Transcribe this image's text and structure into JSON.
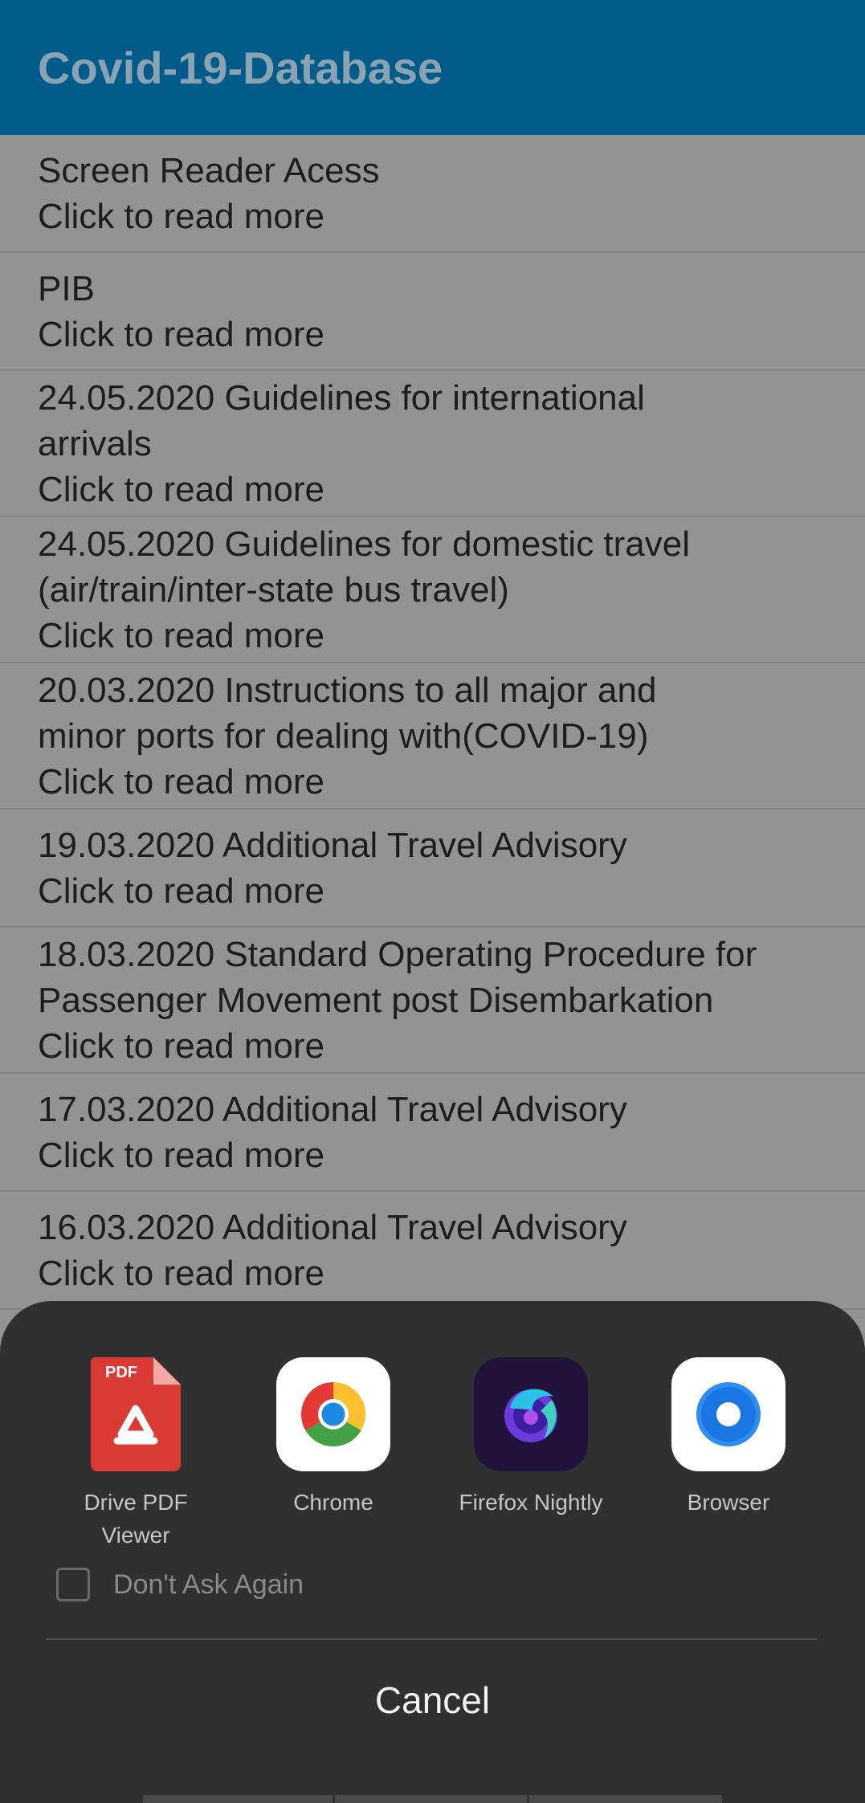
{
  "app": {
    "title": "Covid-19-Database"
  },
  "list": [
    {
      "title": "Screen Reader Acess",
      "sub": "Click to read more"
    },
    {
      "title": "PIB",
      "sub": "Click to read more"
    },
    {
      "title": "24.05.2020 Guidelines for international\narrivals",
      "sub": "Click to read more"
    },
    {
      "title": "24.05.2020 Guidelines for domestic travel\n(air/train/inter-state bus travel)",
      "sub": "Click to read more"
    },
    {
      "title": "20.03.2020 Instructions to all major and\nminor ports for dealing with(COVID-19)",
      "sub": "Click to read more"
    },
    {
      "title": "19.03.2020 Additional Travel Advisory",
      "sub": "Click to read more"
    },
    {
      "title": "18.03.2020 Standard Operating Procedure for\nPassenger Movement post Disembarkation",
      "sub": "Click to read more"
    },
    {
      "title": "17.03.2020 Additional Travel Advisory",
      "sub": "Click to read more"
    },
    {
      "title": "16.03.2020 Additional Travel Advisory",
      "sub": "Click to read more"
    }
  ],
  "chooser": {
    "apps": [
      {
        "label": "Drive PDF\nViewer",
        "icon": "drive-pdf-viewer-icon",
        "badge": "PDF"
      },
      {
        "label": "Chrome",
        "icon": "chrome-icon"
      },
      {
        "label": "Firefox Nightly",
        "icon": "firefox-nightly-icon"
      },
      {
        "label": "Browser",
        "icon": "browser-icon"
      }
    ],
    "dont_ask_label": "Don't Ask Again",
    "cancel_label": "Cancel"
  },
  "colors": {
    "appbar": "#015b88",
    "list_bg": "#939393",
    "sheet_bg": "#303030"
  }
}
